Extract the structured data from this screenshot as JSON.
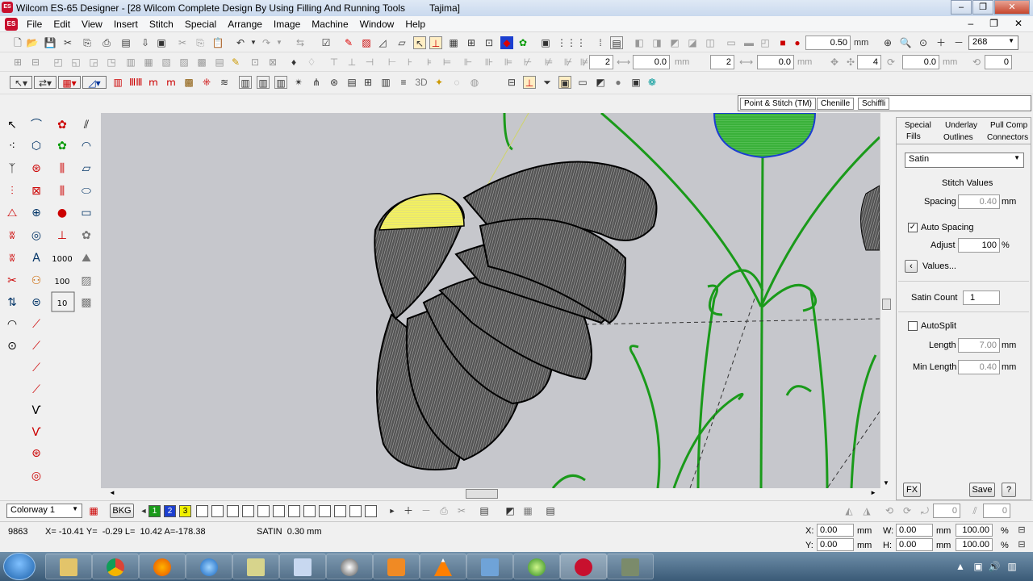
{
  "window": {
    "title": "Wilcom ES-65 Designer - [28 Wilcom Complete Design By Using Filling And Running Tools",
    "title_suffix": "Tajima]",
    "app_badge": "ES"
  },
  "menu": [
    "File",
    "Edit",
    "View",
    "Insert",
    "Stitch",
    "Special",
    "Arrange",
    "Image",
    "Machine",
    "Window",
    "Help"
  ],
  "toolbar1": {
    "stitch_length": "0.50",
    "unit": "mm",
    "zoom": "268"
  },
  "toolbar2": {
    "v1": "2",
    "v2": "0.0",
    "u2": "mm",
    "v3": "2",
    "v4": "0.0",
    "u4": "mm",
    "v5": "4",
    "v6": "0.0",
    "u6": "mm",
    "v7": "0"
  },
  "toolbar3": {
    "label_3d": "3D"
  },
  "prop_tabs": [
    "Point & Stitch (TM)",
    "Chenille",
    "Schiffli"
  ],
  "panel": {
    "tabs_row1": [
      "Special",
      "Underlay",
      "Pull Comp"
    ],
    "tabs_row2": [
      "Fills",
      "Outlines",
      "Connectors"
    ],
    "fill_type": "Satin",
    "stitch_values_label": "Stitch Values",
    "spacing_label": "Spacing",
    "spacing_value": "0.40",
    "spacing_unit": "mm",
    "auto_spacing_label": "Auto Spacing",
    "auto_spacing_checked": true,
    "adjust_label": "Adjust",
    "adjust_value": "100",
    "adjust_unit": "%",
    "values_button": "Values...",
    "satin_count_label": "Satin Count",
    "satin_count_value": "1",
    "autosplit_label": "AutoSplit",
    "autosplit_checked": false,
    "length_label": "Length",
    "length_value": "7.00",
    "length_unit": "mm",
    "min_length_label": "Min Length",
    "min_length_value": "0.40",
    "min_length_unit": "mm",
    "fx_button": "FX",
    "save_button": "Save",
    "help_button": "?"
  },
  "colorbar": {
    "colorway": "Colorway 1",
    "bkg": "BKG",
    "swatches": [
      {
        "n": "1",
        "color": "#1a9a1a"
      },
      {
        "n": "2",
        "color": "#1c3fd0"
      },
      {
        "n": "3",
        "color": "#f0f000"
      }
    ],
    "v1": "0",
    "v2": "0"
  },
  "status": {
    "stitch_no": "9863",
    "coords": "X= -10.41 Y=  -0.29 L=  10.42 A=-178.38",
    "stitch_type": "SATIN  0.30 mm",
    "x_label": "X:",
    "x_val": "0.00",
    "y_label": "Y:",
    "y_val": "0.00",
    "w_label": "W:",
    "w_val": "0.00",
    "h_label": "H:",
    "h_val": "0.00",
    "mm": "mm",
    "pct1": "100.00",
    "pct2": "100.00",
    "pct": "%"
  },
  "taskbar": [
    "start",
    "explorer",
    "chrome",
    "firefox",
    "ie",
    "app5",
    "outlook",
    "itunes",
    "media-player",
    "vlc",
    "screen",
    "greenapp",
    "wilcom",
    "misc"
  ]
}
